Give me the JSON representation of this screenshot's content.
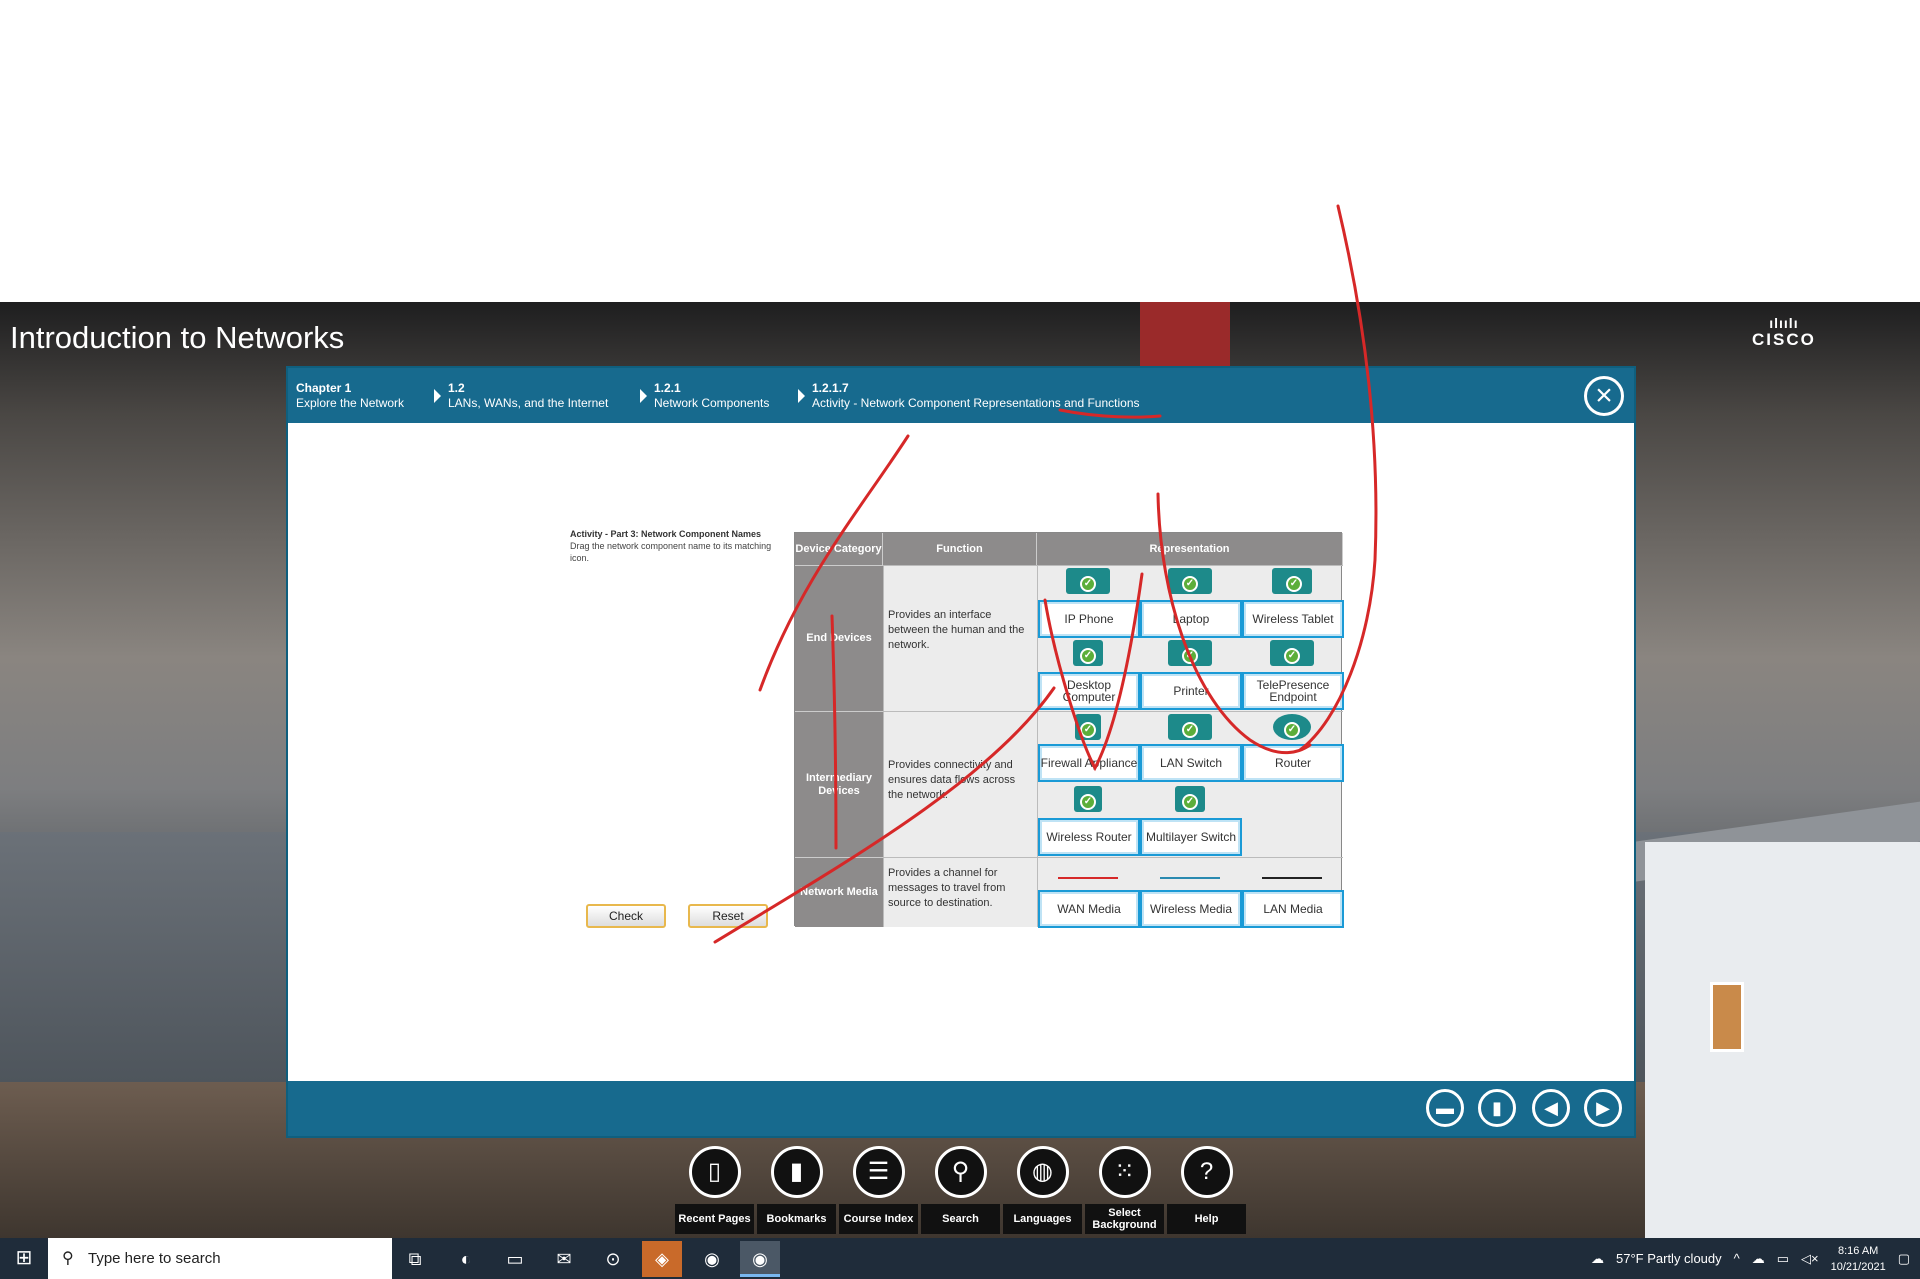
{
  "app_title": "Introduction to Networks",
  "brand": {
    "bars": "ılıılı",
    "name": "CISCO"
  },
  "breadcrumb": [
    {
      "num": "Chapter 1",
      "label": "Explore the Network"
    },
    {
      "num": "1.2",
      "label": "LANs, WANs, and the Internet"
    },
    {
      "num": "1.2.1",
      "label": "Network Components"
    },
    {
      "num": "1.2.1.7",
      "label": "Activity - Network Component Representations and Functions"
    }
  ],
  "activity": {
    "title": "Activity - Part 3: Network Component Names",
    "instruction": "Drag the network component name to its matching icon.",
    "check_label": "Check",
    "reset_label": "Reset",
    "headers": {
      "category": "Device Category",
      "function": "Function",
      "representation": "Representation"
    },
    "rows": [
      {
        "category": "End Devices",
        "function": "Provides an interface between the human and the network.",
        "items": [
          "IP Phone",
          "Laptop",
          "Wireless Tablet",
          "Desktop Computer",
          "Printer",
          "TelePresence Endpoint"
        ]
      },
      {
        "category": "Intermediary Devices",
        "function": "Provides connectivity and ensures data flows across the network.",
        "items": [
          "Firewall Appliance",
          "LAN Switch",
          "Router",
          "Wireless Router",
          "Multilayer Switch"
        ]
      },
      {
        "category": "Network Media",
        "function": "Provides a channel for messages to travel from source to destination.",
        "items": [
          "WAN Media",
          "Wireless Media",
          "LAN Media"
        ]
      }
    ]
  },
  "toolbar": [
    {
      "label": "Recent Pages",
      "icon": "recent-pages-icon"
    },
    {
      "label": "Bookmarks",
      "icon": "bookmark-icon"
    },
    {
      "label": "Course Index",
      "icon": "list-icon"
    },
    {
      "label": "Search",
      "icon": "search-icon"
    },
    {
      "label": "Languages",
      "icon": "globe-icon"
    },
    {
      "label": "Select Background",
      "icon": "grid-icon"
    },
    {
      "label": "Help",
      "icon": "help-icon"
    }
  ],
  "taskbar": {
    "search_placeholder": "Type here to search",
    "weather": "57°F  Partly cloudy",
    "time": "8:16 AM",
    "date": "10/21/2021"
  },
  "colors": {
    "header_blue": "#176a8e",
    "check_green": "#5cae3a",
    "annotation_red": "#d62828"
  }
}
